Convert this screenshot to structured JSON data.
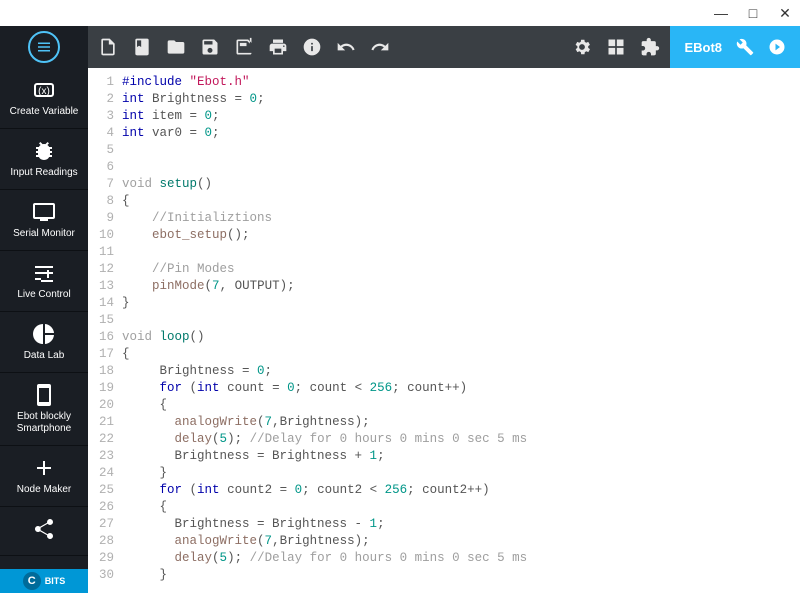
{
  "window": {
    "min": "—",
    "max": "□",
    "close": "✕"
  },
  "device": "EBot8",
  "sidebar": {
    "items": [
      {
        "label": "Create Variable"
      },
      {
        "label": "Input Readings"
      },
      {
        "label": "Serial Monitor"
      },
      {
        "label": "Live Control"
      },
      {
        "label": "Data Lab"
      },
      {
        "label": "Ebot blockly Smartphone"
      },
      {
        "label": "Node Maker"
      },
      {
        "label": ""
      }
    ]
  },
  "bits": {
    "c": "C",
    "txt": "BITS"
  },
  "code": {
    "lines": [
      {
        "n": "1",
        "html": "<span class='tok-kw'>#include</span> <span class='tok-str'>\"Ebot.h\"</span>"
      },
      {
        "n": "2",
        "html": "<span class='tok-kw'>int</span> Brightness = <span class='tok-num'>0</span>;"
      },
      {
        "n": "3",
        "html": "<span class='tok-kw'>int</span> item = <span class='tok-num'>0</span>;"
      },
      {
        "n": "4",
        "html": "<span class='tok-kw'>int</span> var0 = <span class='tok-num'>0</span>;"
      },
      {
        "n": "5",
        "html": ""
      },
      {
        "n": "6",
        "html": ""
      },
      {
        "n": "7",
        "html": "<span class='tok-void'>void</span> <span class='tok-fn'>setup</span>()"
      },
      {
        "n": "8",
        "html": "{"
      },
      {
        "n": "9",
        "html": "    <span class='tok-cm'>//Initializtions</span>"
      },
      {
        "n": "10",
        "html": "    <span class='tok-fn2'>ebot_setup</span>();"
      },
      {
        "n": "11",
        "html": ""
      },
      {
        "n": "12",
        "html": "    <span class='tok-cm'>//Pin Modes</span>"
      },
      {
        "n": "13",
        "html": "    <span class='tok-fn2'>pinMode</span>(<span class='tok-num'>7</span>, OUTPUT);"
      },
      {
        "n": "14",
        "html": "}"
      },
      {
        "n": "15",
        "html": ""
      },
      {
        "n": "16",
        "html": "<span class='tok-void'>void</span> <span class='tok-fn'>loop</span>()"
      },
      {
        "n": "17",
        "html": "{"
      },
      {
        "n": "18",
        "html": "     Brightness = <span class='tok-num'>0</span>;"
      },
      {
        "n": "19",
        "html": "     <span class='tok-kw'>for</span> (<span class='tok-kw'>int</span> count = <span class='tok-num'>0</span>; count &lt; <span class='tok-num'>256</span>; count++)"
      },
      {
        "n": "20",
        "html": "     {"
      },
      {
        "n": "21",
        "html": "       <span class='tok-fn2'>analogWrite</span>(<span class='tok-num'>7</span>,Brightness);"
      },
      {
        "n": "22",
        "html": "       <span class='tok-fn2'>delay</span>(<span class='tok-num'>5</span>); <span class='tok-cm'>//Delay for 0 hours 0 mins 0 sec 5 ms</span>"
      },
      {
        "n": "23",
        "html": "       Brightness = Brightness + <span class='tok-num'>1</span>;"
      },
      {
        "n": "24",
        "html": "     }"
      },
      {
        "n": "25",
        "html": "     <span class='tok-kw'>for</span> (<span class='tok-kw'>int</span> count2 = <span class='tok-num'>0</span>; count2 &lt; <span class='tok-num'>256</span>; count2++)"
      },
      {
        "n": "26",
        "html": "     {"
      },
      {
        "n": "27",
        "html": "       Brightness = Brightness - <span class='tok-num'>1</span>;"
      },
      {
        "n": "28",
        "html": "       <span class='tok-fn2'>analogWrite</span>(<span class='tok-num'>7</span>,Brightness);"
      },
      {
        "n": "29",
        "html": "       <span class='tok-fn2'>delay</span>(<span class='tok-num'>5</span>); <span class='tok-cm'>//Delay for 0 hours 0 mins 0 sec 5 ms</span>"
      },
      {
        "n": "30",
        "html": "     }"
      }
    ]
  }
}
